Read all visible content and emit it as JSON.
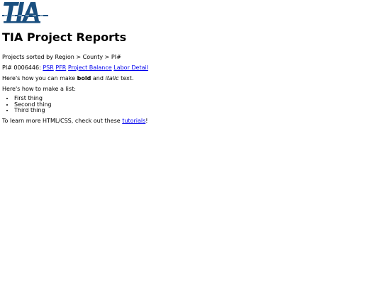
{
  "logo": {
    "text": "TIA",
    "colors": {
      "primary": "#1a4f7f",
      "accent": "#ffffff"
    }
  },
  "header": {
    "title": "TIA Project Reports"
  },
  "breadcrumb": {
    "text": "Projects sorted by Region > County > PI#"
  },
  "project": {
    "label": "PI# 0006446:",
    "links": [
      "PSR",
      "PFR",
      "Project Balance",
      "Labor Detail"
    ]
  },
  "formatting": {
    "prefix": "Here's how you can make",
    "bold": "bold",
    "middle": "and",
    "italic": "italic",
    "suffix": "text."
  },
  "list_intro": "Here's how to make a list:",
  "list_items": [
    "First thing",
    "Second thing",
    "Third thing"
  ],
  "footer": {
    "prefix": "To learn more HTML/CSS, check out these",
    "link": "tutorials",
    "suffix": "!"
  },
  "colors": {
    "link": "#0000ee",
    "text": "#000000",
    "background": "#ffffff"
  }
}
